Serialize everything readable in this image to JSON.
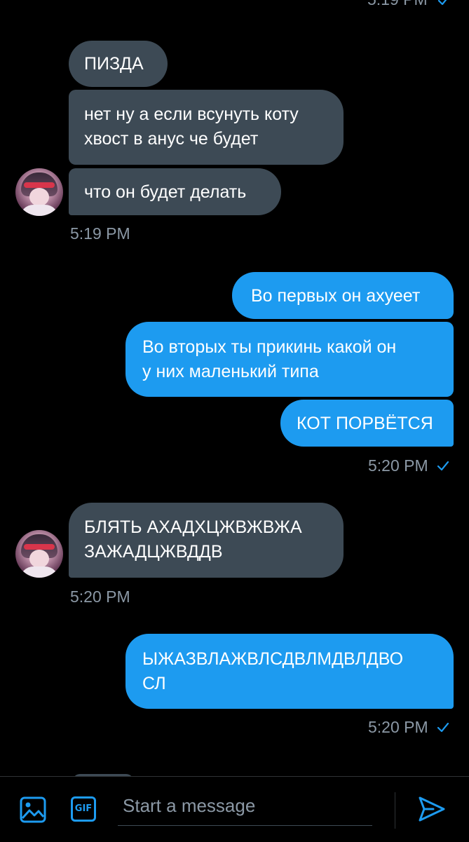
{
  "messages": {
    "top_time": "5:19 PM",
    "m1": "ПИЗДА",
    "m2_line1": "нет ну а если всунуть коту",
    "m2_line2": "хвост в анус че будет",
    "m3": "что он будет делать",
    "t1": "5:19 PM",
    "m4": "Во первых он ахуеет",
    "m5_line1": "Во вторых ты прикинь какой он",
    "m5_line2": "у них маленький типа",
    "m6": "КОТ ПОРВЁТСЯ",
    "t2": "5:20 PM",
    "m7_line1": "БЛЯТЬ АХАДХЦЖВЖВЖА",
    "m7_line2": "ЗАЖАДЦЖВДДВ",
    "t3": "5:20 PM",
    "m8_line1": "ЫЖАЗВЛАЖВЛСДВЛМДВЛДВО",
    "m8_line2": "СЛ",
    "t4": "5:20 PM"
  },
  "composer": {
    "placeholder": "Start a message",
    "gif_label": "GIF"
  },
  "colors": {
    "received_bubble": "#3d4a55",
    "sent_bubble": "#1d9bf0",
    "timestamp": "#8b98a5",
    "accent": "#1d9bf0"
  },
  "icons": [
    "image-icon",
    "gif-icon",
    "send-icon",
    "read-check-icon",
    "avatar"
  ]
}
